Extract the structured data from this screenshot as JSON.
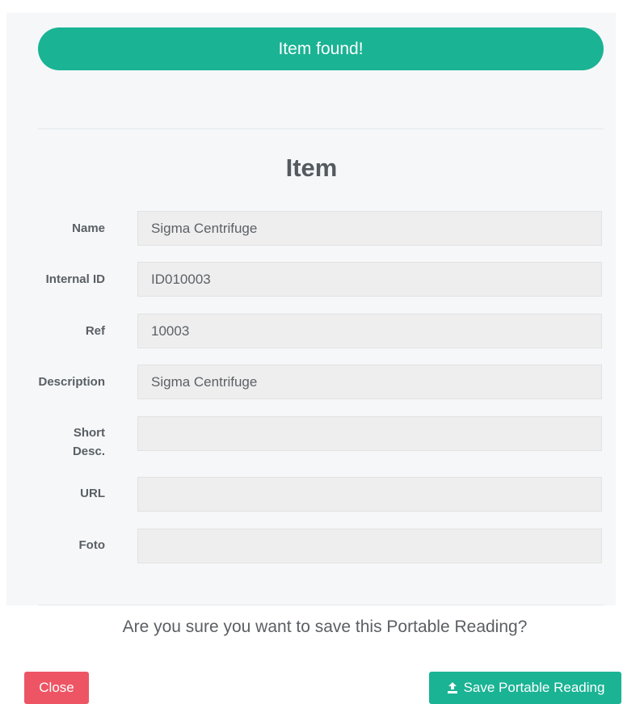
{
  "banner": {
    "text": "Item found!"
  },
  "section": {
    "title": "Item"
  },
  "fields": [
    {
      "label": "Name",
      "value": "Sigma Centrifuge"
    },
    {
      "label": "Internal ID",
      "value": "ID010003"
    },
    {
      "label": "Ref",
      "value": "10003"
    },
    {
      "label": "Description",
      "value": "Sigma Centrifuge"
    },
    {
      "label_line1": "Short",
      "label_line2": "Desc.",
      "value": ""
    },
    {
      "label": "URL",
      "value": ""
    },
    {
      "label": "Foto",
      "value": ""
    }
  ],
  "confirm": {
    "question": "Are you sure you want to save this Portable Reading?"
  },
  "buttons": {
    "close_label": "Close",
    "save_label": "Save Portable Reading",
    "save_icon": "upload-icon"
  },
  "colors": {
    "accent": "#1ab394",
    "danger": "#ed5565",
    "panel": "#f5f7f9",
    "field": "#eeeeee"
  }
}
